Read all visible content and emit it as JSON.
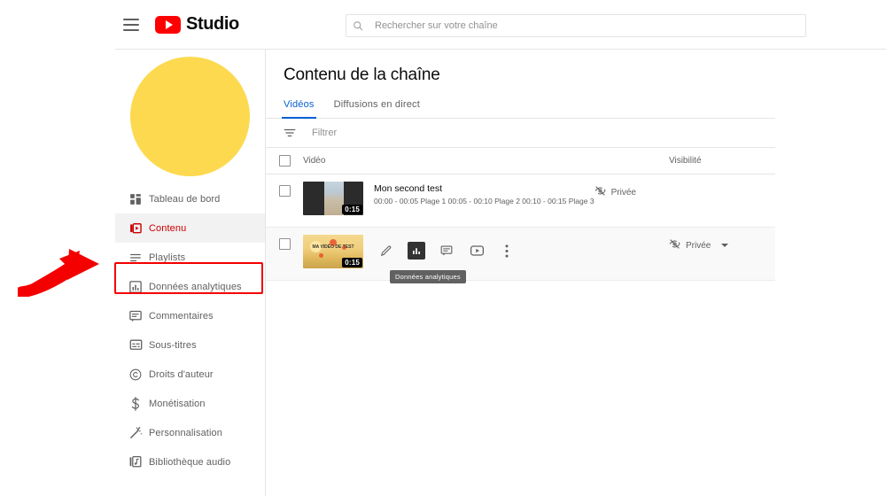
{
  "header": {
    "menu_icon": "hamburger-menu-icon",
    "brand": "Studio",
    "logo_icon": "youtube-logo-icon"
  },
  "search": {
    "icon": "search-icon",
    "placeholder": "Rechercher sur votre chaîne",
    "value": ""
  },
  "sidebar": {
    "avatar_color": "#FDD94F",
    "items": [
      {
        "label": "Tableau de bord",
        "icon": "dashboard-icon",
        "active": false
      },
      {
        "label": "Contenu",
        "icon": "content-videos-icon",
        "active": true
      },
      {
        "label": "Playlists",
        "icon": "playlists-icon",
        "active": false
      },
      {
        "label": "Données analytiques",
        "icon": "analytics-bar-chart-icon",
        "active": false
      },
      {
        "label": "Commentaires",
        "icon": "comments-icon",
        "active": false
      },
      {
        "label": "Sous-titres",
        "icon": "subtitles-icon",
        "active": false
      },
      {
        "label": "Droits d'auteur",
        "icon": "copyright-icon",
        "active": false
      },
      {
        "label": "Monétisation",
        "icon": "dollar-monetization-icon",
        "active": false
      },
      {
        "label": "Personnalisation",
        "icon": "magic-wand-customization-icon",
        "active": false
      },
      {
        "label": "Bibliothèque audio",
        "icon": "audio-library-icon",
        "active": false
      }
    ]
  },
  "annotation": {
    "highlight_color": "#F40000",
    "target_label": "Données analytiques",
    "arrow_icon": "red-curved-arrow-icon"
  },
  "main": {
    "title": "Contenu de la chaîne",
    "tabs": [
      {
        "label": "Vidéos",
        "active": true
      },
      {
        "label": "Diffusions en direct",
        "active": false
      }
    ],
    "active_tab_color": "#065FD4",
    "filter": {
      "icon": "filter-icon",
      "placeholder": "Filtrer"
    },
    "table": {
      "columns": {
        "select": "",
        "video": "Vidéo",
        "visibility": "Visibilité"
      },
      "rows": [
        {
          "title": "Mon second test",
          "description": "00:00 - 00:05 Plage 1 00:05 - 00:10 Plage 2 00:10 - 00:15 Plage 3",
          "duration": "0:15",
          "visibility": "Privée",
          "visibility_icon": "eye-off-private-icon",
          "hovered": false
        },
        {
          "title": "",
          "description": "",
          "duration": "0:15",
          "thumbnail_overlay": "MA VIDÉO DE TEST",
          "visibility": "Privée",
          "visibility_icon": "eye-off-private-icon",
          "hovered": true
        }
      ]
    },
    "row_actions": [
      {
        "label": "Modifier",
        "icon": "pencil-edit-icon",
        "highlighted": false
      },
      {
        "label": "Données analytiques",
        "icon": "analytics-bar-chart-icon",
        "highlighted": true
      },
      {
        "label": "Commentaires",
        "icon": "comments-icon",
        "highlighted": false
      },
      {
        "label": "Voir sur YouTube",
        "icon": "youtube-play-icon",
        "highlighted": false
      },
      {
        "label": "Options",
        "icon": "more-vertical-icon",
        "highlighted": false
      }
    ],
    "tooltip": "Données analytiques"
  }
}
